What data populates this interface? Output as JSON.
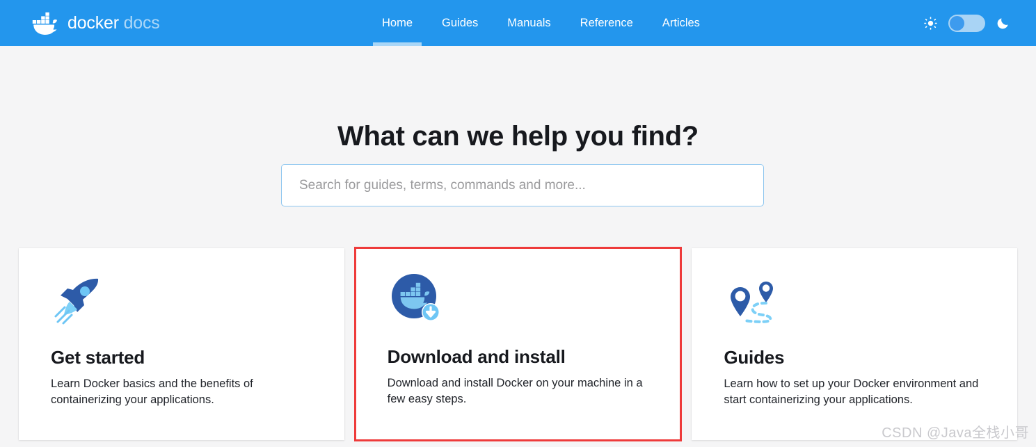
{
  "header": {
    "brand": {
      "logo_icon": "docker-whale-icon",
      "word_primary": "docker",
      "word_secondary": "docs"
    },
    "nav_items": [
      {
        "label": "Home",
        "active": true
      },
      {
        "label": "Guides",
        "active": false
      },
      {
        "label": "Manuals",
        "active": false
      },
      {
        "label": "Reference",
        "active": false
      },
      {
        "label": "Articles",
        "active": false
      }
    ],
    "theme": {
      "light_icon": "sun-icon",
      "dark_icon": "moon-icon",
      "toggle_state": "light"
    },
    "background_color": "#2396ED"
  },
  "hero": {
    "title": "What can we help you find?",
    "search": {
      "placeholder": "Search for guides, terms, commands and more...",
      "value": "",
      "border_color": "#8CC5EF"
    }
  },
  "cards": [
    {
      "icon": "rocket-icon",
      "title": "Get started",
      "description": "Learn Docker basics and the benefits of containerizing your applications.",
      "highlighted": false
    },
    {
      "icon": "docker-download-icon",
      "title": "Download and install",
      "description": "Download and install Docker on your machine in a few easy steps.",
      "highlighted": true,
      "highlight_color": "#EE3B3B"
    },
    {
      "icon": "map-pins-route-icon",
      "title": "Guides",
      "description": "Learn how to set up your Docker environment and start containerizing your applications.",
      "highlighted": false
    }
  ],
  "watermark": {
    "text": "CSDN @Java全栈小哥"
  },
  "colors": {
    "brand_blue": "#2396ED",
    "page_background": "#F5F5F6",
    "card_background": "#FFFFFF",
    "icon_dark_blue": "#2D5BA8",
    "icon_light_blue": "#7DC6F0",
    "active_underline": "#A9D6F7"
  }
}
